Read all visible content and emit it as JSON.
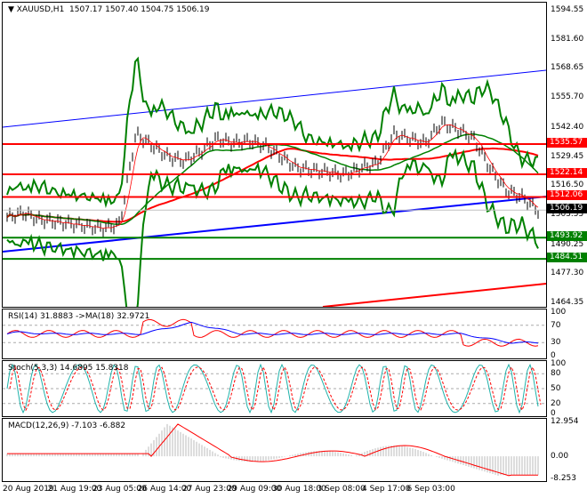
{
  "header": {
    "symbol": "XAUUSD,H1",
    "ohlc": "1507.17 1507.40 1504.75 1506.19"
  },
  "price_axis": [
    "1594.55",
    "1581.60",
    "1568.65",
    "1555.70",
    "1542.40",
    "1529.45",
    "1516.50",
    "1503.55",
    "1490.25",
    "1477.30",
    "1464.35"
  ],
  "levels": [
    {
      "label": "1535.57",
      "color": "#ff0000"
    },
    {
      "label": "1522.14",
      "color": "#ff0000"
    },
    {
      "label": "1512.06",
      "color": "#ff0000"
    },
    {
      "label": "1493.92",
      "color": "#008000"
    },
    {
      "label": "1484.51",
      "color": "#008000"
    }
  ],
  "current_price": "1506.19",
  "rsi": {
    "title": "RSI(14) 31.8883  ->MA(18) 32.9721",
    "axis": [
      "100",
      "70",
      "30",
      "0"
    ]
  },
  "stoch": {
    "title": "Stoch(5,3,3) 14.6895 15.8318",
    "axis": [
      "100",
      "80",
      "50",
      "20",
      "0"
    ]
  },
  "macd": {
    "title": "MACD(12,26,9) -7.103 -6.882",
    "axis": [
      "12.954",
      "0.00",
      "-8.253"
    ]
  },
  "dates": [
    "20 Aug 2019",
    "21 Aug 19:00",
    "23 Aug 05:00",
    "26 Aug 14:00",
    "27 Aug 23:00",
    "29 Aug 09:00",
    "30 Aug 18:00",
    "3 Sep 08:00",
    "4 Sep 17:00",
    "6 Sep 03:00"
  ],
  "chart_data": {
    "type": "line",
    "title": "XAUUSD,H1",
    "ylim": [
      1464.35,
      1594.55
    ],
    "close_approx": [
      1503,
      1505,
      1502,
      1501,
      1500,
      1499,
      1498,
      1500,
      1540,
      1535,
      1530,
      1528,
      1532,
      1538,
      1536,
      1537,
      1535,
      1530,
      1525,
      1524,
      1523,
      1522,
      1525,
      1527,
      1540,
      1538,
      1536,
      1545,
      1542,
      1538,
      1525,
      1515,
      1512,
      1506
    ]
  }
}
